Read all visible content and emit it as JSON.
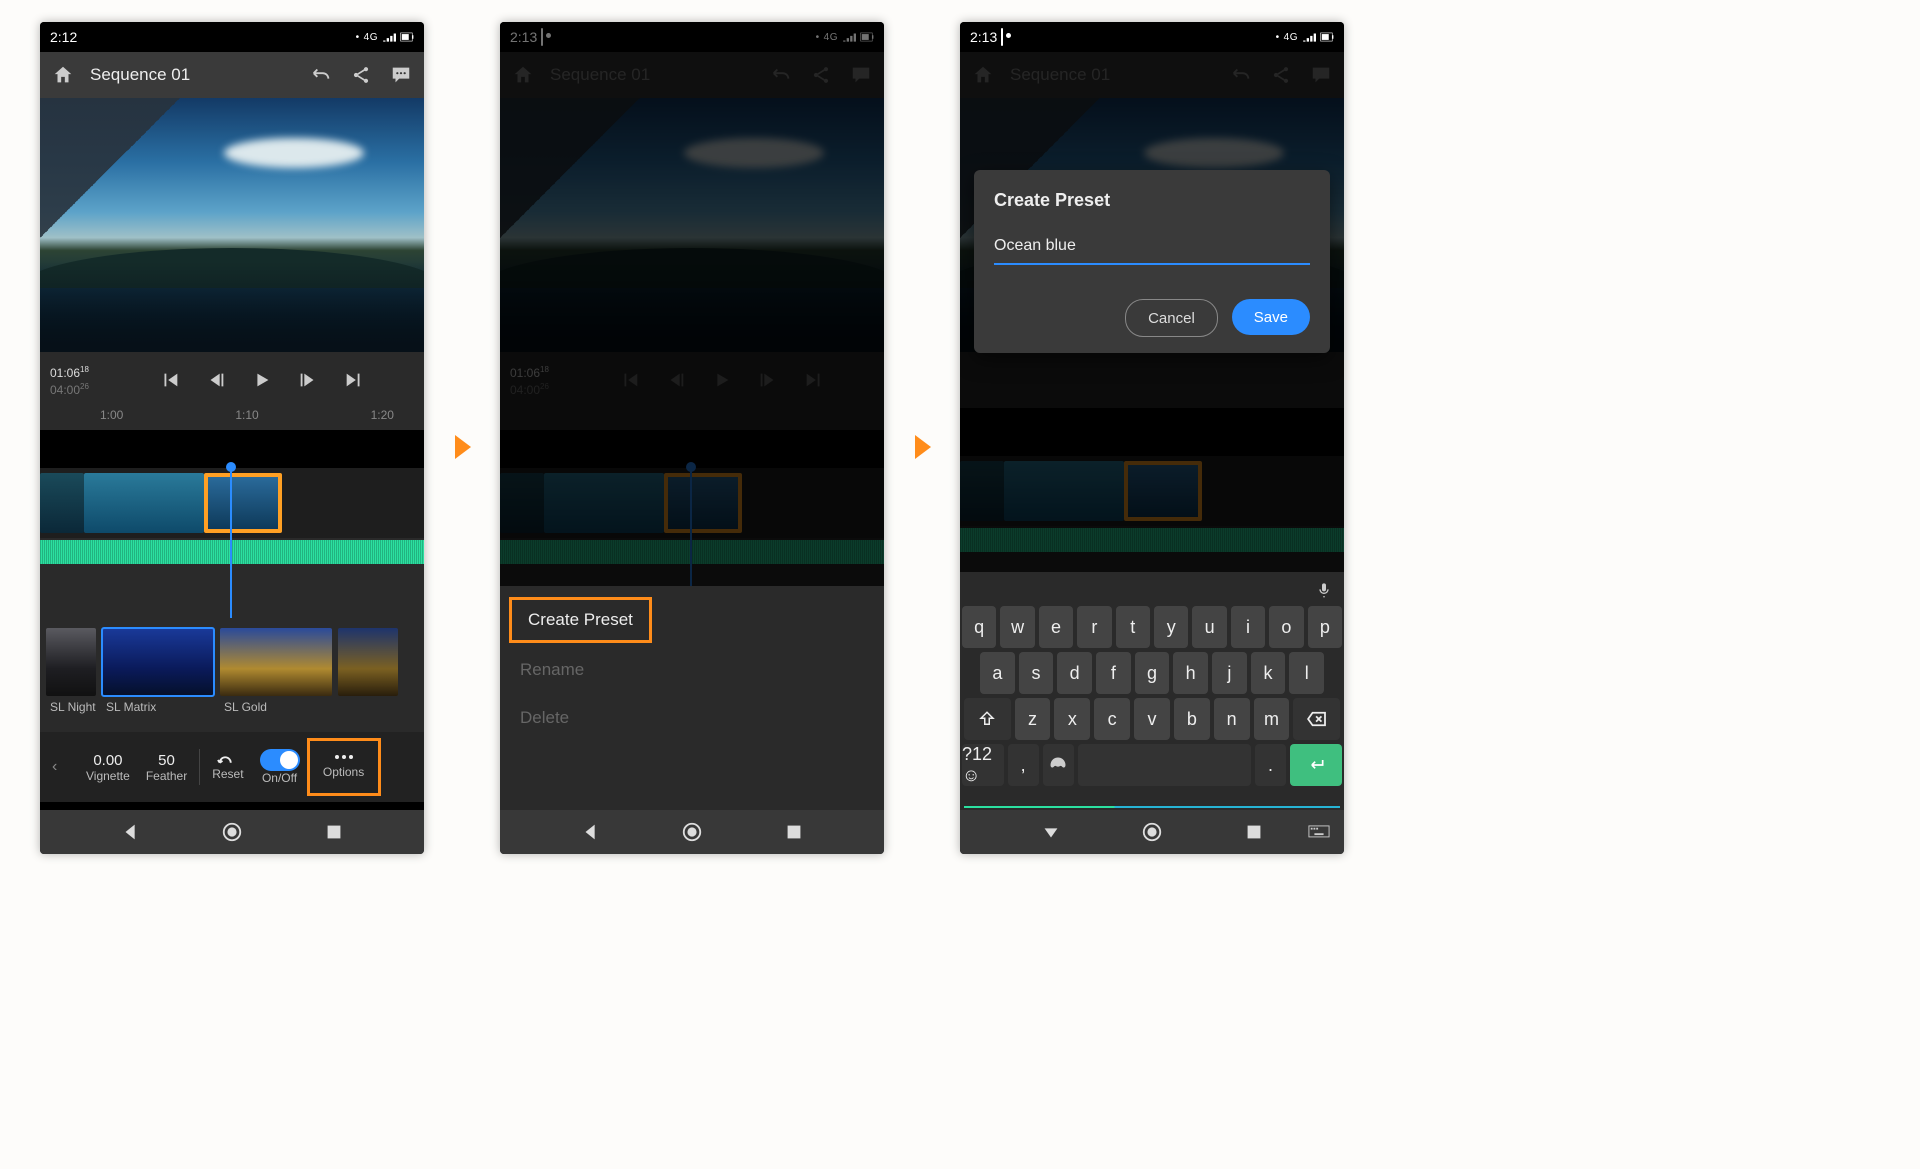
{
  "screens": [
    {
      "status": {
        "time": "2:12",
        "net": "4G"
      },
      "header": {
        "title": "Sequence 01"
      },
      "transport": {
        "current": "01:06",
        "current_frames": "18",
        "total": "04:00",
        "total_frames": "26"
      },
      "ruler": {
        "a": "1:00",
        "b": "1:10",
        "c": "1:20"
      },
      "presets": [
        {
          "label": "SL Night",
          "thumb": "night",
          "selected": false
        },
        {
          "label": "SL Matrix",
          "thumb": "matrix",
          "selected": true
        },
        {
          "label": "SL Gold",
          "thumb": "gold",
          "selected": false
        }
      ],
      "controls": {
        "vignette_value": "0.00",
        "vignette_label": "Vignette",
        "feather_value": "50",
        "feather_label": "Feather",
        "reset_label": "Reset",
        "onoff_label": "On/Off",
        "options_label": "Options"
      }
    },
    {
      "status": {
        "time": "2:13",
        "net": "4G"
      },
      "header": {
        "title": "Sequence 01"
      },
      "transport": {
        "current": "01:06",
        "current_frames": "18",
        "total": "04:00",
        "total_frames": "26"
      },
      "menu": {
        "create": "Create Preset",
        "rename": "Rename",
        "delete": "Delete"
      }
    },
    {
      "status": {
        "time": "2:13",
        "net": "4G"
      },
      "header": {
        "title": "Sequence 01"
      },
      "dialog": {
        "title": "Create Preset",
        "value": "Ocean blue",
        "cancel": "Cancel",
        "save": "Save"
      },
      "keyboard": {
        "row1": [
          "q",
          "w",
          "e",
          "r",
          "t",
          "y",
          "u",
          "i",
          "o",
          "p"
        ],
        "row2": [
          "a",
          "s",
          "d",
          "f",
          "g",
          "h",
          "j",
          "k",
          "l"
        ],
        "row3": [
          "z",
          "x",
          "c",
          "v",
          "b",
          "n",
          "m"
        ],
        "sym": "?12☺",
        "comma": ",",
        "period": "."
      }
    }
  ]
}
